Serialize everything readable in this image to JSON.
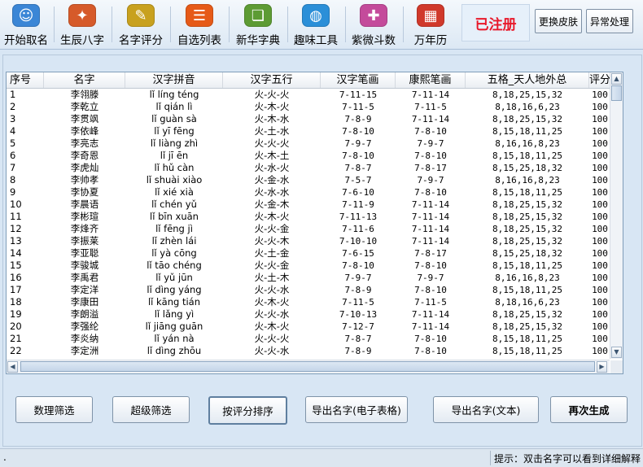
{
  "toolbar": {
    "items": [
      {
        "label": "开始取名",
        "icon": "users-icon",
        "color": "#3b86d6"
      },
      {
        "label": "生辰八字",
        "icon": "compass-icon",
        "color": "#d65a2a"
      },
      {
        "label": "名字评分",
        "icon": "edit-notebook-icon",
        "color": "#c8a11f"
      },
      {
        "label": "自选列表",
        "icon": "list-icon",
        "color": "#e65a18"
      },
      {
        "label": "新华字典",
        "icon": "book-icon",
        "color": "#5d9b34"
      },
      {
        "label": "趣味工具",
        "icon": "globe-icon",
        "color": "#2b8fd8"
      },
      {
        "label": "紫微斗数",
        "icon": "star-icon",
        "color": "#c44b9b"
      },
      {
        "label": "万年历",
        "icon": "calendar-icon",
        "color": "#d0392b"
      }
    ],
    "registered": "已注册",
    "skin_button": "更换皮肤",
    "exception_button": "异常处理"
  },
  "grid": {
    "headers": [
      "序号",
      "名字",
      "汉字拼音",
      "汉字五行",
      "汉字笔画",
      "康熙笔画",
      "五格_天人地外总",
      "评分"
    ],
    "rows": [
      [
        "1",
        "李翎滕",
        "lǐ líng téng",
        "火-火-火",
        "7-11-15",
        "7-11-14",
        "8,18,25,15,32",
        "100"
      ],
      [
        "2",
        "李乾立",
        "lǐ qián lì",
        "火-木-火",
        "7-11-5",
        "7-11-5",
        "8,18,16,6,23",
        "100"
      ],
      [
        "3",
        "李贯飒",
        "lǐ guàn sà",
        "火-木-水",
        "7-8-9",
        "7-11-14",
        "8,18,25,15,32",
        "100"
      ],
      [
        "4",
        "李依峰",
        "lǐ yī fēng",
        "火-土-水",
        "7-8-10",
        "7-8-10",
        "8,15,18,11,25",
        "100"
      ],
      [
        "5",
        "李亮志",
        "lǐ liàng zhì",
        "火-火-火",
        "7-9-7",
        "7-9-7",
        "8,16,16,8,23",
        "100"
      ],
      [
        "6",
        "李奇恩",
        "lǐ jī ēn",
        "火-木-土",
        "7-8-10",
        "7-8-10",
        "8,15,18,11,25",
        "100"
      ],
      [
        "7",
        "李虎灿",
        "lǐ hǔ càn",
        "火-水-火",
        "7-8-7",
        "7-8-17",
        "8,15,25,18,32",
        "100"
      ],
      [
        "8",
        "李帅孝",
        "lǐ shuài xiào",
        "火-金-水",
        "7-5-7",
        "7-9-7",
        "8,16,16,8,23",
        "100"
      ],
      [
        "9",
        "李协夏",
        "lǐ xié xià",
        "火-水-水",
        "7-6-10",
        "7-8-10",
        "8,15,18,11,25",
        "100"
      ],
      [
        "10",
        "李晨语",
        "lǐ chén yǔ",
        "火-金-木",
        "7-11-9",
        "7-11-14",
        "8,18,25,15,32",
        "100"
      ],
      [
        "11",
        "李彬瑄",
        "lǐ bīn xuān",
        "火-木-火",
        "7-11-13",
        "7-11-14",
        "8,18,25,15,32",
        "100"
      ],
      [
        "12",
        "李烽齐",
        "lǐ fēng jì",
        "火-火-金",
        "7-11-6",
        "7-11-14",
        "8,18,25,15,32",
        "100"
      ],
      [
        "13",
        "李振莱",
        "lǐ zhèn lái",
        "火-火-木",
        "7-10-10",
        "7-11-14",
        "8,18,25,15,32",
        "100"
      ],
      [
        "14",
        "李亚聪",
        "lǐ yà cōng",
        "火-土-金",
        "7-6-15",
        "7-8-17",
        "8,15,25,18,32",
        "100"
      ],
      [
        "15",
        "李骏城",
        "lǐ tāo chéng",
        "火-火-金",
        "7-8-10",
        "7-8-10",
        "8,15,18,11,25",
        "100"
      ],
      [
        "16",
        "李禹君",
        "lǐ yǔ jūn",
        "火-土-木",
        "7-9-7",
        "7-9-7",
        "8,16,16,8,23",
        "100"
      ],
      [
        "17",
        "李定洋",
        "lǐ dìng yáng",
        "火-火-水",
        "7-8-9",
        "7-8-10",
        "8,15,18,11,25",
        "100"
      ],
      [
        "18",
        "李康田",
        "lǐ kāng tián",
        "火-木-火",
        "7-11-5",
        "7-11-5",
        "8,18,16,6,23",
        "100"
      ],
      [
        "19",
        "李朗溢",
        "lǐ lǎng yì",
        "火-火-水",
        "7-10-13",
        "7-11-14",
        "8,18,25,15,32",
        "100"
      ],
      [
        "20",
        "李强纶",
        "lǐ jiāng guān",
        "火-木-火",
        "7-12-7",
        "7-11-14",
        "8,18,25,15,32",
        "100"
      ],
      [
        "21",
        "李炎纳",
        "lǐ yán nà",
        "火-火-火",
        "7-8-7",
        "7-8-10",
        "8,15,18,11,25",
        "100"
      ],
      [
        "22",
        "李定洲",
        "lǐ dìng zhōu",
        "火-火-水",
        "7-8-9",
        "7-8-10",
        "8,15,18,11,25",
        "100"
      ]
    ]
  },
  "buttons": {
    "numerology_filter": "数理筛选",
    "super_filter": "超级筛选",
    "sort_by_score": "按评分排序",
    "export_excel": "导出名字(电子表格)",
    "export_text": "导出名字(文本)",
    "regenerate": "再次生成"
  },
  "status": {
    "left": ".",
    "hint": "提示：双击名字可以看到详细解释"
  }
}
